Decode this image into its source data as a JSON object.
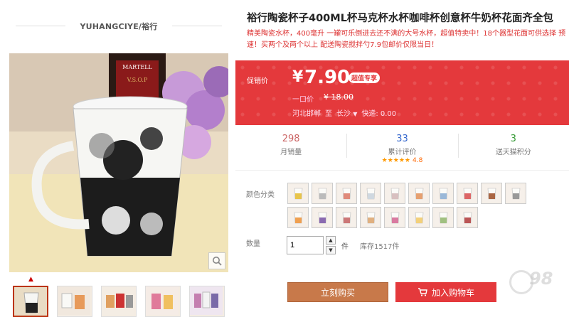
{
  "shop": {
    "name": "YUHANGCIYE/裕行"
  },
  "product": {
    "title": "裕行陶瓷杯子400ML杯马克杯水杯咖啡杯创意杯牛奶杯花面齐全包",
    "subtitle": "精美陶瓷水杯，400毫升 一罐可乐倒进去还不满的大号水杯，超值特卖中！18个器型花面可供选择 预速！买两个及两个以上 配送陶瓷搅拌勺7.9包邮价仅限当日！"
  },
  "price": {
    "promo_label": "促销价",
    "currency": "¥",
    "value": "7.90",
    "tag": "超值专享",
    "original_label": "一口价",
    "original_currency": "¥",
    "original_value": "18.00",
    "ship_from": "河北邯郸",
    "ship_to_word": "至",
    "ship_dest": "长沙",
    "express": "快递: 0.00"
  },
  "stats": [
    {
      "num": "298",
      "label": "月销量",
      "color": "#c66"
    },
    {
      "num": "33",
      "label": "累计评价",
      "color": "#36c",
      "stars": "★★★★★",
      "score": "4.8"
    },
    {
      "num": "3",
      "label": "送天猫积分",
      "color": "#393"
    }
  ],
  "color_label": "颜色分类",
  "swatch_count": 18,
  "quantity": {
    "label": "数量",
    "value": "1",
    "unit": "件",
    "stock": "库存1517件"
  },
  "actions": {
    "buy": "立刻购买",
    "cart": "加入购物车"
  },
  "watermark": "98",
  "colors": {
    "accent": "#e4393c",
    "buy": "#c8794a"
  }
}
